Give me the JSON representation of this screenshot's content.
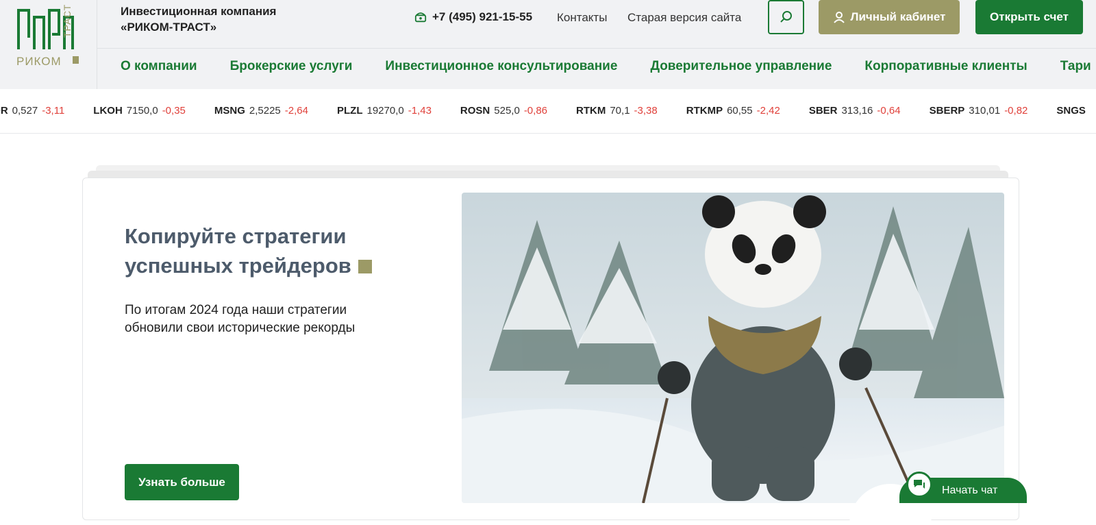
{
  "header": {
    "company_line1": "Инвестиционная компания",
    "company_line2": "«РИКОМ-ТРАСТ»",
    "phone": "+7 (495) 921-15-55",
    "contacts": "Контакты",
    "old_site": "Старая версия сайта",
    "cabinet": "Личный кабинет",
    "open_account": "Открыть счет"
  },
  "logo": {
    "text_bottom": "РИКОМ",
    "text_side": "ТРАСТ"
  },
  "nav": [
    "О компании",
    "Брокерские услуги",
    "Инвестиционное консультирование",
    "Доверительное управление",
    "Корпоративные клиенты",
    "Тари"
  ],
  "ticker": [
    {
      "sym": "DR",
      "price": "0,527",
      "chg": "-3,11"
    },
    {
      "sym": "LKOH",
      "price": "7150,0",
      "chg": "-0,35"
    },
    {
      "sym": "MSNG",
      "price": "2,5225",
      "chg": "-2,64"
    },
    {
      "sym": "PLZL",
      "price": "19270,0",
      "chg": "-1,43"
    },
    {
      "sym": "ROSN",
      "price": "525,0",
      "chg": "-0,86"
    },
    {
      "sym": "RTKM",
      "price": "70,1",
      "chg": "-3,38"
    },
    {
      "sym": "RTKMP",
      "price": "60,55",
      "chg": "-2,42"
    },
    {
      "sym": "SBER",
      "price": "313,16",
      "chg": "-0,64"
    },
    {
      "sym": "SBERP",
      "price": "310,01",
      "chg": "-0,82"
    },
    {
      "sym": "SNGS",
      "price": "",
      "chg": ""
    }
  ],
  "hero": {
    "title_line1": "Копируйте стратегии",
    "title_line2": "успешных трейдеров",
    "text_line1": "По итогам 2024 года наши стратегии",
    "text_line2": "обновили свои исторические рекорды",
    "button": "Узнать больше"
  },
  "chat": {
    "label": "Начать чат"
  },
  "colors": {
    "green": "#1a7a34",
    "olive": "#9c9a66",
    "red": "#e0403a"
  }
}
